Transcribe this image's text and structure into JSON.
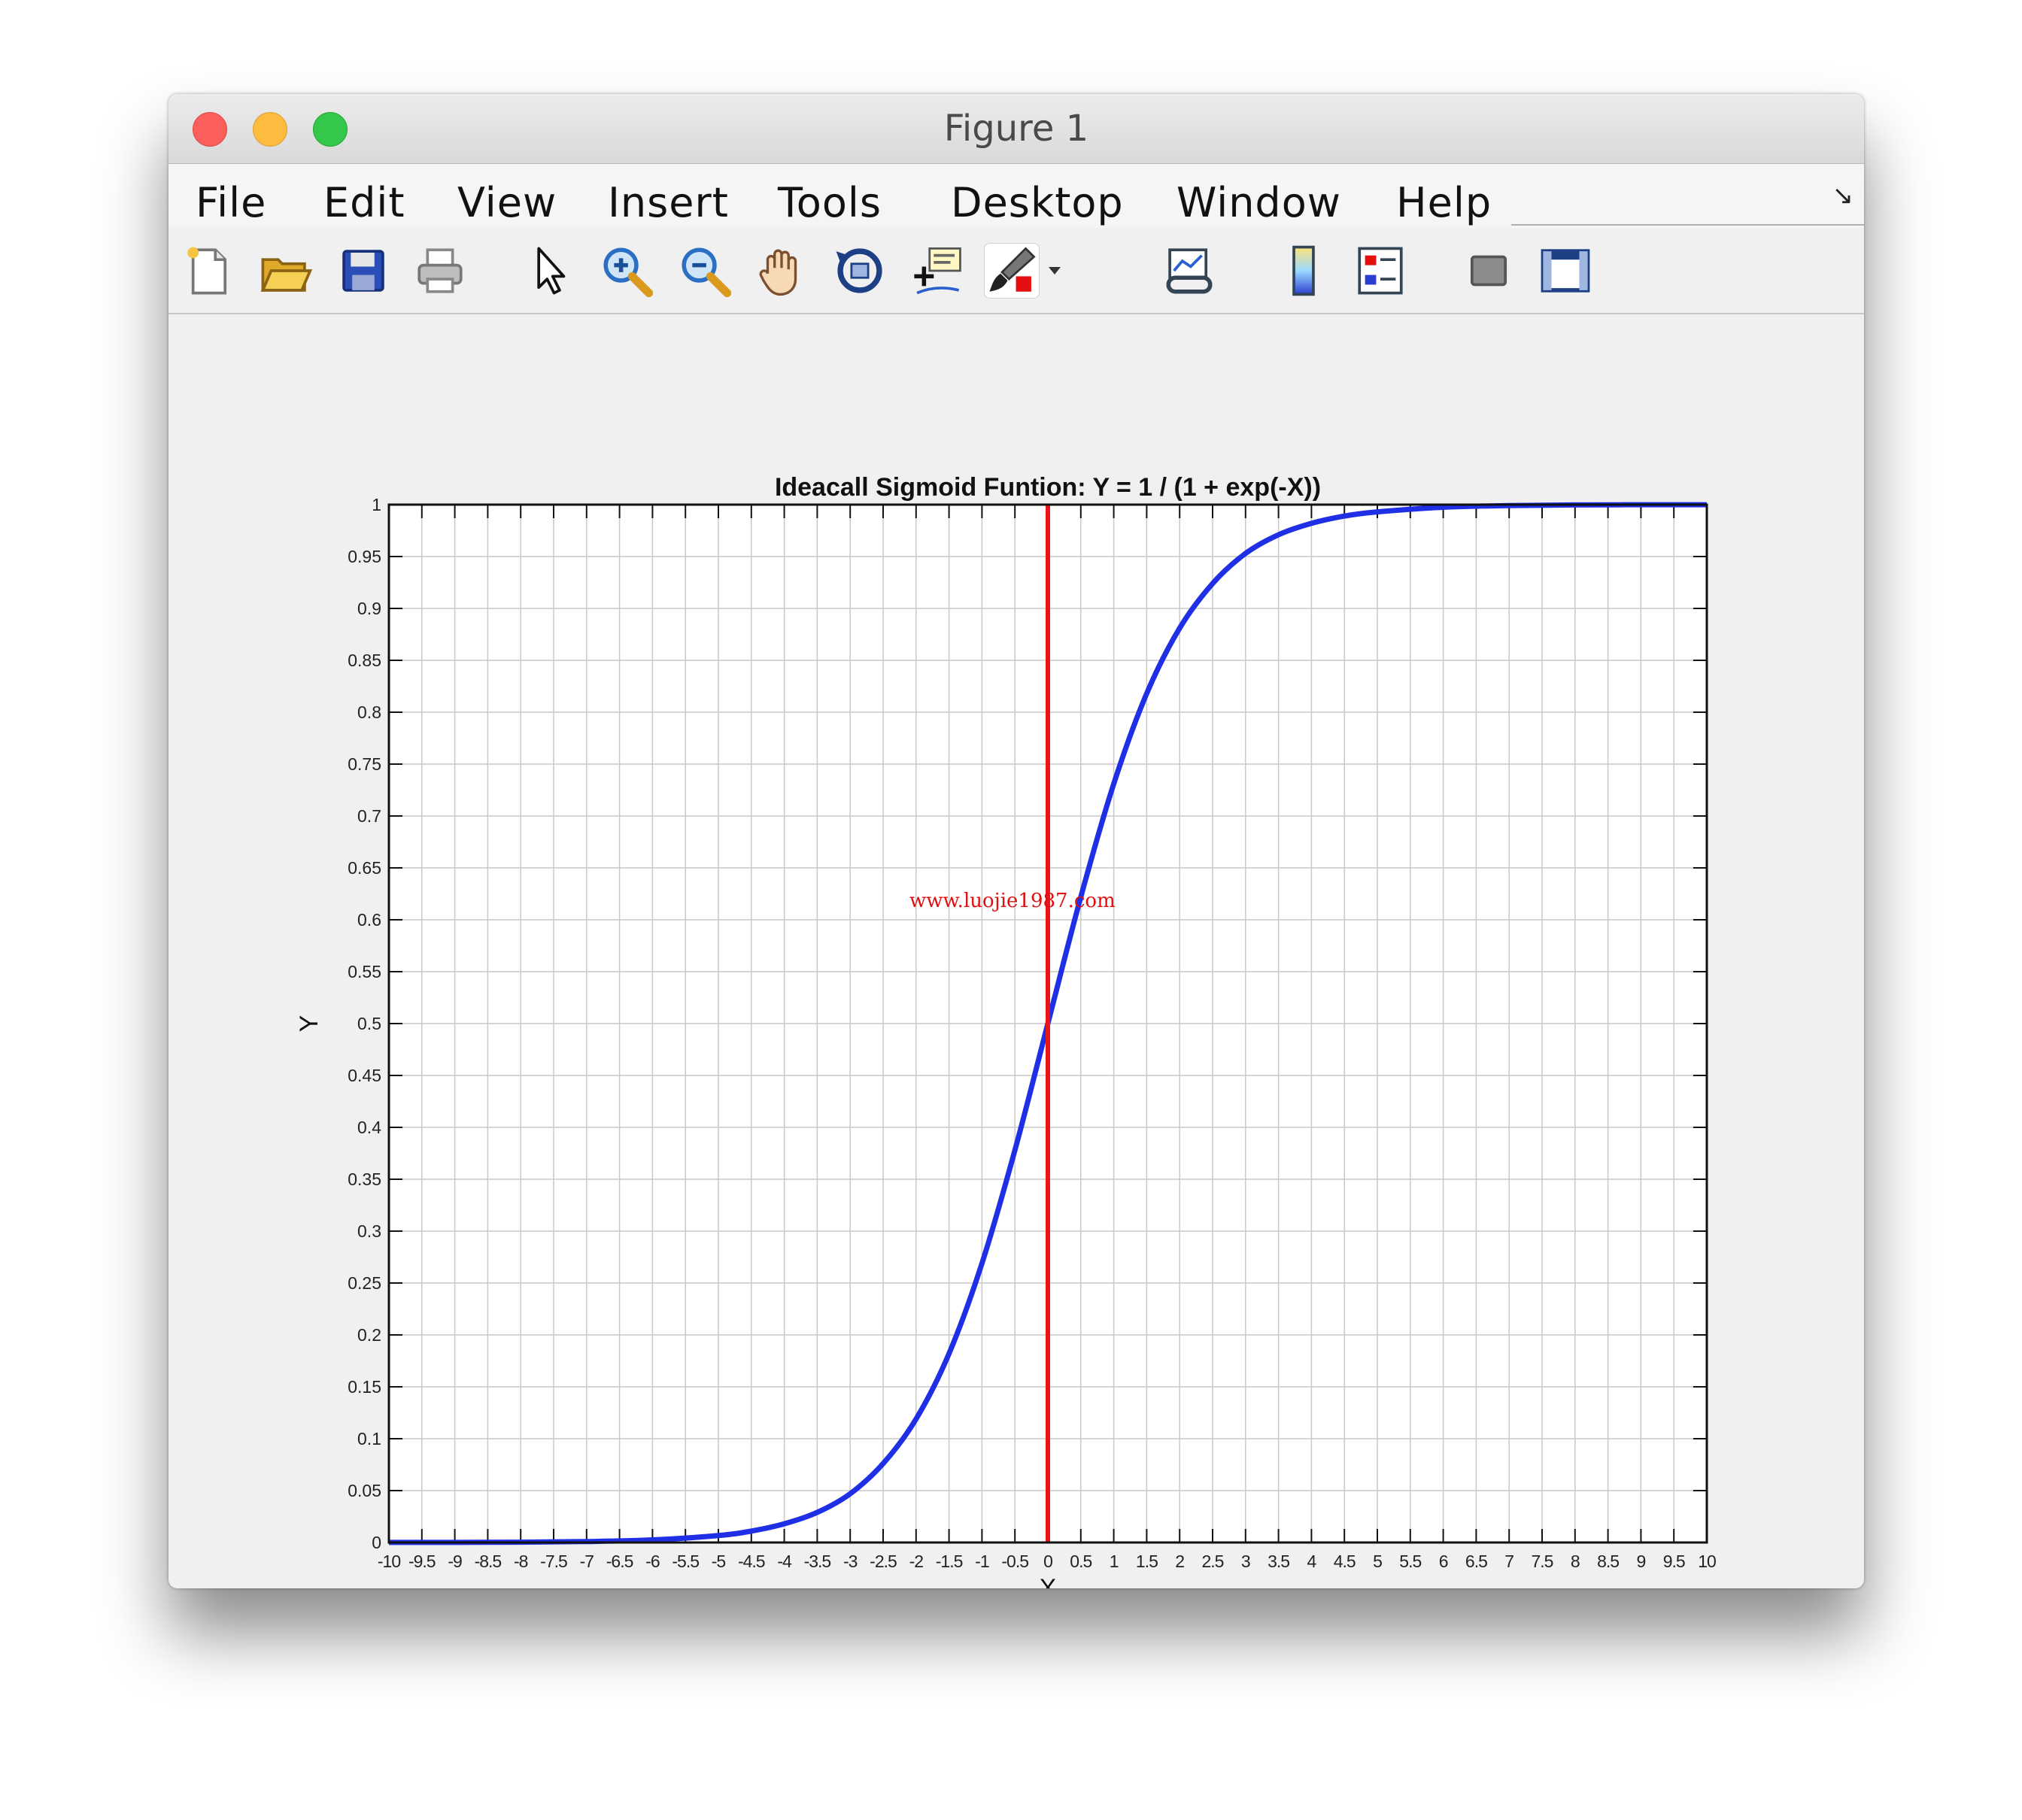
{
  "window": {
    "title": "Figure 1"
  },
  "menu": {
    "items": [
      "File",
      "Edit",
      "View",
      "Insert",
      "Tools",
      "Desktop",
      "Window",
      "Help"
    ]
  },
  "toolbar": {
    "icons": [
      "new-figure-icon",
      "open-file-icon",
      "save-icon",
      "print-icon",
      "edit-plot-arrow-icon",
      "zoom-in-icon",
      "zoom-out-icon",
      "pan-hand-icon",
      "rotate-3d-icon",
      "data-cursor-icon",
      "brush-icon",
      "brush-dropdown-icon",
      "link-plot-icon",
      "colorbar-icon",
      "legend-icon",
      "hide-plot-tools-icon",
      "show-plot-tools-icon"
    ]
  },
  "watermark": "www.luojie1987.com",
  "chart_data": {
    "type": "line",
    "title": "Ideacall Sigmoid Funtion: Y = 1 / (1 + exp(-X))",
    "xlabel": "X",
    "ylabel": "Y",
    "xlim": [
      -10,
      10
    ],
    "ylim": [
      0,
      1
    ],
    "grid": true,
    "x_ticks": [
      -10,
      -9.5,
      -9,
      -8.5,
      -8,
      -7.5,
      -7,
      -6.5,
      -6,
      -5.5,
      -5,
      -4.5,
      -4,
      -3.5,
      -3,
      -2.5,
      -2,
      -1.5,
      -1,
      -0.5,
      0,
      0.5,
      1,
      1.5,
      2,
      2.5,
      3,
      3.5,
      4,
      4.5,
      5,
      5.5,
      6,
      6.5,
      7,
      7.5,
      8,
      8.5,
      9,
      9.5,
      10
    ],
    "x_tick_labels": [
      "-10",
      "-9.5",
      "-9",
      "-8.5",
      "-8",
      "-7.5",
      "-7",
      "-6.5",
      "-6",
      "-5.5",
      "-5",
      "-4.5",
      "-4",
      "-3.5",
      "-3",
      "-2.5",
      "-2",
      "-1.5",
      "-1",
      "-0.5",
      "0",
      "0.5",
      "1",
      "1.5",
      "2",
      "2.5",
      "3",
      "3.5",
      "4",
      "4.5",
      "5",
      "5.5",
      "6",
      "6.5",
      "7",
      "7.5",
      "8",
      "8.5",
      "9",
      "9.5",
      "10"
    ],
    "y_ticks": [
      0,
      0.05,
      0.1,
      0.15,
      0.2,
      0.25,
      0.3,
      0.35,
      0.4,
      0.45,
      0.5,
      0.55,
      0.6,
      0.65,
      0.7,
      0.75,
      0.8,
      0.85,
      0.9,
      0.95,
      1
    ],
    "y_tick_labels": [
      "0",
      "0.05",
      "0.1",
      "0.15",
      "0.2",
      "0.25",
      "0.3",
      "0.35",
      "0.4",
      "0.45",
      "0.5",
      "0.55",
      "0.6",
      "0.65",
      "0.7",
      "0.75",
      "0.8",
      "0.85",
      "0.9",
      "0.95",
      "1"
    ],
    "series": [
      {
        "color": "#1f2fe6",
        "x": [
          -10,
          -9,
          -8,
          -7,
          -6,
          -5,
          -4.5,
          -4,
          -3.5,
          -3,
          -2.5,
          -2,
          -1.5,
          -1,
          -0.5,
          0,
          0.5,
          1,
          1.5,
          2,
          2.5,
          3,
          3.5,
          4,
          4.5,
          5,
          6,
          7,
          8,
          9,
          10
        ],
        "y": [
          5e-05,
          0.0001,
          0.0003,
          0.0009,
          0.0025,
          0.0067,
          0.011,
          0.018,
          0.029,
          0.047,
          0.076,
          0.119,
          0.182,
          0.269,
          0.378,
          0.5,
          0.622,
          0.731,
          0.818,
          0.881,
          0.924,
          0.953,
          0.971,
          0.982,
          0.989,
          0.993,
          0.9975,
          0.9991,
          0.9997,
          0.9999,
          0.99995
        ]
      },
      {
        "color": "#e8161b",
        "x": [
          0,
          0
        ],
        "y": [
          0,
          1
        ]
      }
    ]
  }
}
